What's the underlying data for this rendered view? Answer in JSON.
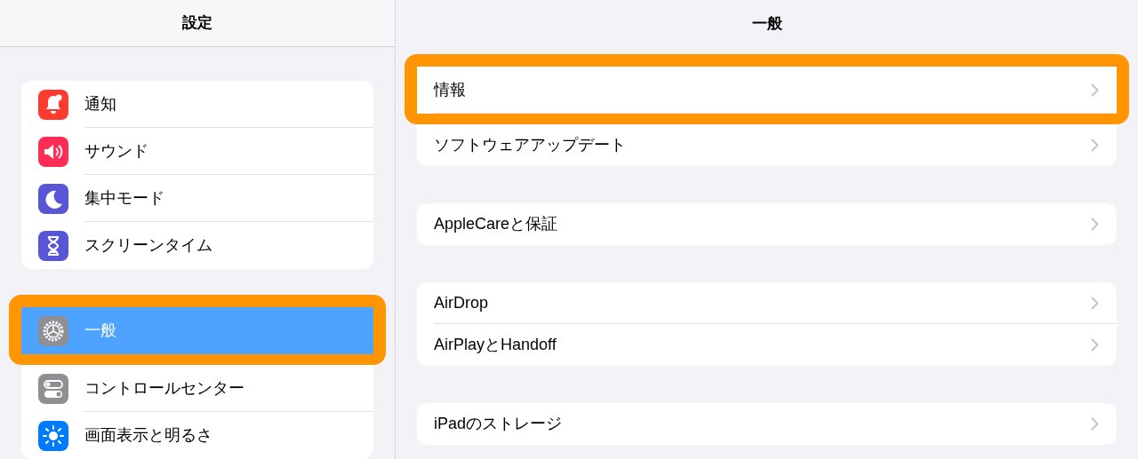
{
  "sidebar": {
    "title": "設定",
    "groups": [
      {
        "items": [
          {
            "label": "通知",
            "color": "#ff3b30",
            "selected": false,
            "highlighted": false
          },
          {
            "label": "サウンド",
            "color": "#ff2d55",
            "selected": false,
            "highlighted": false
          },
          {
            "label": "集中モード",
            "color": "#5856d6",
            "selected": false,
            "highlighted": false
          },
          {
            "label": "スクリーンタイム",
            "color": "#5856d6",
            "selected": false,
            "highlighted": false
          }
        ]
      },
      {
        "items": [
          {
            "label": "一般",
            "color": "#8e8e93",
            "selected": true,
            "highlighted": true
          },
          {
            "label": "コントロールセンター",
            "color": "#8e8e93",
            "selected": false,
            "highlighted": false
          },
          {
            "label": "画面表示と明るさ",
            "color": "#007aff",
            "selected": false,
            "highlighted": false
          }
        ]
      }
    ]
  },
  "detail": {
    "title": "一般",
    "groups": [
      {
        "items": [
          {
            "label": "情報",
            "highlighted": true
          },
          {
            "label": "ソフトウェアアップデート",
            "highlighted": false
          }
        ]
      },
      {
        "items": [
          {
            "label": "AppleCareと保証",
            "highlighted": false
          }
        ]
      },
      {
        "items": [
          {
            "label": "AirDrop",
            "highlighted": false
          },
          {
            "label": "AirPlayとHandoff",
            "highlighted": false
          }
        ]
      },
      {
        "items": [
          {
            "label": "iPadのストレージ",
            "highlighted": false
          }
        ]
      }
    ]
  }
}
